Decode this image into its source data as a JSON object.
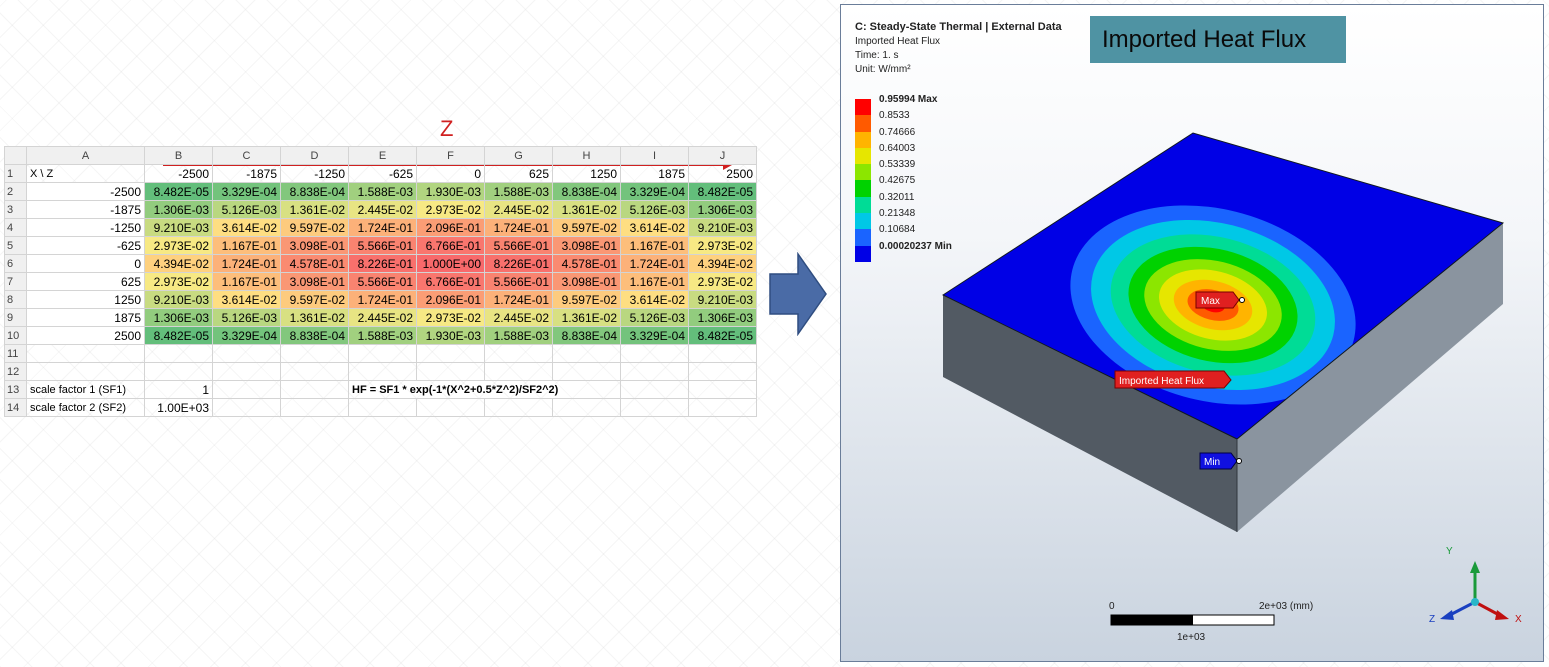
{
  "spreadsheet": {
    "columns": [
      "A",
      "B",
      "C",
      "D",
      "E",
      "F",
      "G",
      "H",
      "I",
      "J"
    ],
    "header_label": "X \\ Z",
    "z_values": [
      "-2500",
      "-1875",
      "-1250",
      "-625",
      "0",
      "625",
      "1250",
      "1875",
      "2500"
    ],
    "rows": [
      {
        "x": "-2500",
        "cells": [
          "8.482E-05",
          "3.329E-04",
          "8.838E-04",
          "1.588E-03",
          "1.930E-03",
          "1.588E-03",
          "8.838E-04",
          "3.329E-04",
          "8.482E-05"
        ]
      },
      {
        "x": "-1875",
        "cells": [
          "1.306E-03",
          "5.126E-03",
          "1.361E-02",
          "2.445E-02",
          "2.973E-02",
          "2.445E-02",
          "1.361E-02",
          "5.126E-03",
          "1.306E-03"
        ]
      },
      {
        "x": "-1250",
        "cells": [
          "9.210E-03",
          "3.614E-02",
          "9.597E-02",
          "1.724E-01",
          "2.096E-01",
          "1.724E-01",
          "9.597E-02",
          "3.614E-02",
          "9.210E-03"
        ]
      },
      {
        "x": "-625",
        "cells": [
          "2.973E-02",
          "1.167E-01",
          "3.098E-01",
          "5.566E-01",
          "6.766E-01",
          "5.566E-01",
          "3.098E-01",
          "1.167E-01",
          "2.973E-02"
        ]
      },
      {
        "x": "0",
        "cells": [
          "4.394E-02",
          "1.724E-01",
          "4.578E-01",
          "8.226E-01",
          "1.000E+00",
          "8.226E-01",
          "4.578E-01",
          "1.724E-01",
          "4.394E-02"
        ]
      },
      {
        "x": "625",
        "cells": [
          "2.973E-02",
          "1.167E-01",
          "3.098E-01",
          "5.566E-01",
          "6.766E-01",
          "5.566E-01",
          "3.098E-01",
          "1.167E-01",
          "2.973E-02"
        ]
      },
      {
        "x": "1250",
        "cells": [
          "9.210E-03",
          "3.614E-02",
          "9.597E-02",
          "1.724E-01",
          "2.096E-01",
          "1.724E-01",
          "9.597E-02",
          "3.614E-02",
          "9.210E-03"
        ]
      },
      {
        "x": "1875",
        "cells": [
          "1.306E-03",
          "5.126E-03",
          "1.361E-02",
          "2.445E-02",
          "2.973E-02",
          "2.445E-02",
          "1.361E-02",
          "5.126E-03",
          "1.306E-03"
        ]
      },
      {
        "x": "2500",
        "cells": [
          "8.482E-05",
          "3.329E-04",
          "8.838E-04",
          "1.588E-03",
          "1.930E-03",
          "1.588E-03",
          "8.838E-04",
          "3.329E-04",
          "8.482E-05"
        ]
      }
    ],
    "row_numbers": [
      "1",
      "2",
      "3",
      "4",
      "5",
      "6",
      "7",
      "8",
      "9",
      "10",
      "11",
      "12",
      "13",
      "14"
    ],
    "sf1_label": "scale factor 1 (SF1)",
    "sf1_value": "1",
    "sf2_label": "scale factor 2 (SF2)",
    "sf2_value": "1.00E+03",
    "formula": "HF = SF1 * exp(-1*(X^2+0.5*Z^2)/SF2^2)",
    "z_axis_label": "Z",
    "x_axis_label": "X",
    "heat_colors": {
      "low": "#63be7b",
      "mid": "#ffeb84",
      "high": "#f8696b"
    }
  },
  "viewer": {
    "title": "C: Steady-State Thermal | External Data",
    "subtitle": "Imported Heat Flux",
    "time": "Time: 1. s",
    "unit": "Unit: W/mm²",
    "banner": "Imported Heat Flux",
    "legend": [
      {
        "label": "0.95994 Max",
        "color": "#ff0000",
        "bold": true
      },
      {
        "label": "0.8533",
        "color": "#ff5a00",
        "bold": false
      },
      {
        "label": "0.74666",
        "color": "#ffb400",
        "bold": false
      },
      {
        "label": "0.64003",
        "color": "#e6e600",
        "bold": false
      },
      {
        "label": "0.53339",
        "color": "#8ce600",
        "bold": false
      },
      {
        "label": "0.42675",
        "color": "#00d200",
        "bold": false
      },
      {
        "label": "0.32011",
        "color": "#00dc96",
        "bold": false
      },
      {
        "label": "0.21348",
        "color": "#00c8e6",
        "bold": false
      },
      {
        "label": "0.10684",
        "color": "#1a64ff",
        "bold": false
      },
      {
        "label": "0.00020237 Min",
        "color": "#0000e6",
        "bold": true
      }
    ],
    "max_tag": "Max",
    "min_tag": "Min",
    "load_tag": "Imported Heat Flux",
    "scale": {
      "zero": "0",
      "end": "2e+03 (mm)",
      "mid": "1e+03"
    },
    "triad": {
      "y": "Y",
      "x": "X",
      "z": "Z"
    }
  }
}
